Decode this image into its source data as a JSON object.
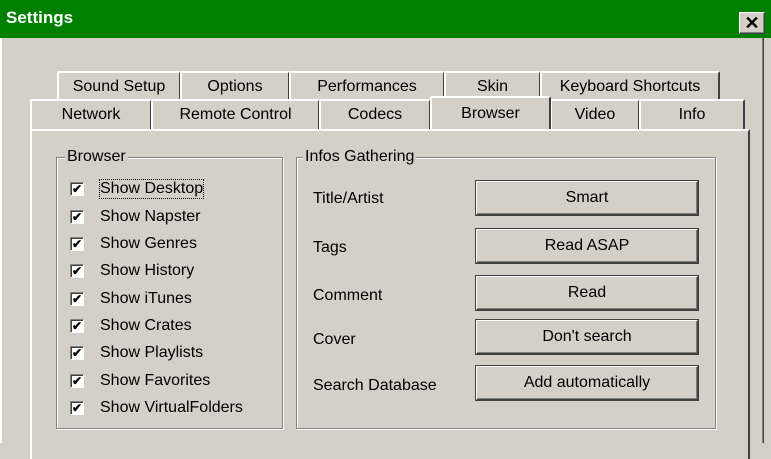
{
  "window": {
    "title": "Settings",
    "close_symbol": "✕",
    "titlebar_color": "#008000"
  },
  "tabs_back_row": [
    "Sound Setup",
    "Options",
    "Performances",
    "Skin",
    "Keyboard Shortcuts"
  ],
  "tabs_front_row": [
    "Network",
    "Remote Control",
    "Codecs",
    "Browser",
    "Video",
    "Info"
  ],
  "active_tab": "Browser",
  "browser_group": {
    "label": "Browser",
    "items": [
      {
        "label": "Show Desktop",
        "checked": true
      },
      {
        "label": "Show Napster",
        "checked": true
      },
      {
        "label": "Show Genres",
        "checked": true
      },
      {
        "label": "Show History",
        "checked": true
      },
      {
        "label": "Show iTunes",
        "checked": true
      },
      {
        "label": "Show Crates",
        "checked": true
      },
      {
        "label": "Show Playlists",
        "checked": true
      },
      {
        "label": "Show Favorites",
        "checked": true
      },
      {
        "label": "Show VirtualFolders",
        "checked": true
      }
    ]
  },
  "infos_group": {
    "label": "Infos Gathering",
    "rows": [
      {
        "label": "Title/Artist",
        "value": "Smart"
      },
      {
        "label": "Tags",
        "value": "Read ASAP"
      },
      {
        "label": "Comment",
        "value": "Read"
      },
      {
        "label": "Cover",
        "value": "Don't search"
      },
      {
        "label": "Search Database",
        "value": "Add automatically"
      }
    ]
  },
  "check_glyph": "✔"
}
